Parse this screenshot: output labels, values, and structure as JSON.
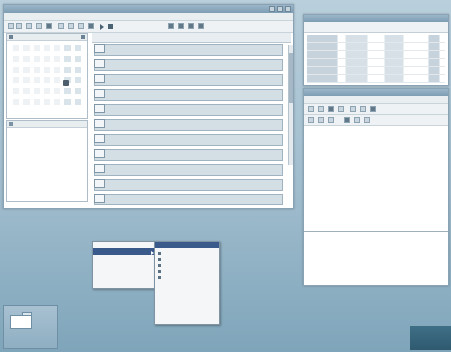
{
  "colors": {
    "desktop": "#9fbccd",
    "titlebar": "#7d9db3",
    "selection": "#3a5a8c"
  },
  "main_window": {
    "title": "",
    "menu": [
      "",
      "",
      "",
      "",
      "",
      ""
    ],
    "toolbar_icons": [
      "back-icon",
      "forward-icon",
      "new-icon",
      "open-icon",
      "save-icon",
      "print-icon",
      "cut-icon",
      "copy-icon",
      "paste-icon",
      "play-icon",
      "stop-icon",
      "view-icon",
      "view-icon",
      "view-icon",
      "view-icon"
    ],
    "row_icon_names": [
      "note-icon",
      "note-icon",
      "note-icon",
      "note-icon",
      "note-icon",
      "note-icon",
      "note-icon",
      "note-icon",
      "note-icon",
      "note-icon",
      "note-icon"
    ]
  },
  "top_right_window": {
    "title": ""
  },
  "mid_right_window": {
    "title": "",
    "menu": [
      "",
      "",
      "",
      "",
      "",
      ""
    ]
  },
  "context_menu": {
    "items": [
      "",
      "",
      "",
      "",
      "",
      ""
    ],
    "submenu_items": [
      "",
      "",
      "",
      "",
      "",
      "",
      "",
      "",
      "",
      "",
      "",
      "",
      "",
      "",
      ""
    ]
  },
  "taskbar": {
    "icons": [
      "window-icon"
    ]
  }
}
